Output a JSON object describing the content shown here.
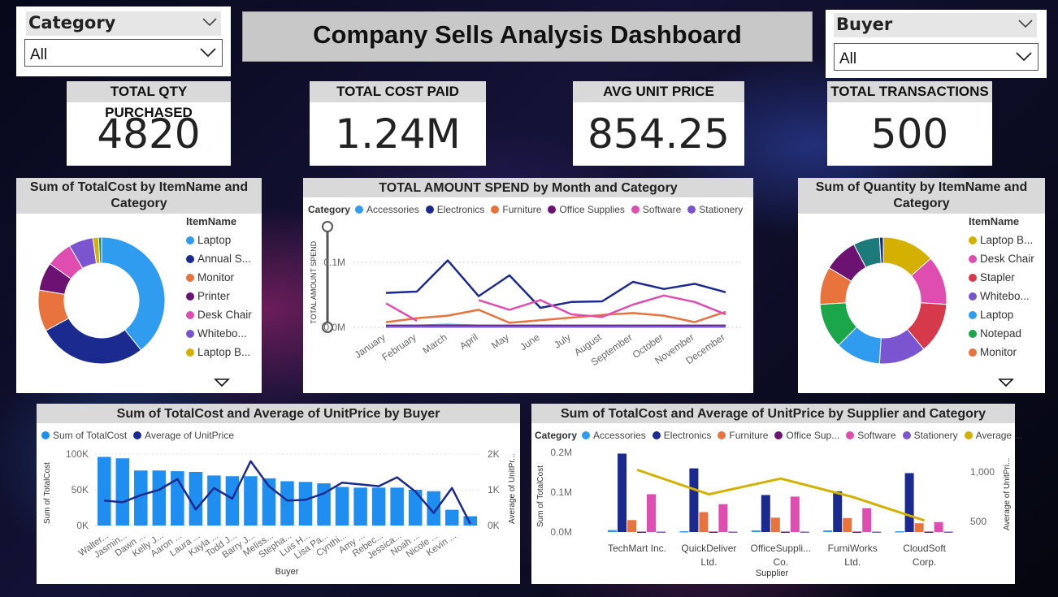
{
  "dashboard_title": "Company Sells Analysis Dashboard",
  "slicers": {
    "category": {
      "label": "Category",
      "value": "All"
    },
    "buyer": {
      "label": "Buyer",
      "value": "All"
    }
  },
  "kpis": [
    {
      "label": "TOTAL QTY PURCHASED",
      "value": "4820"
    },
    {
      "label": "TOTAL COST PAID",
      "value": "1.24M"
    },
    {
      "label": "AVG UNIT PRICE",
      "value": "854.25"
    },
    {
      "label": "TOTAL TRANSACTIONS",
      "value": "500"
    }
  ],
  "colors": {
    "Accessories": "#2f9cf0",
    "Electronics": "#1a2a8f",
    "Furniture": "#e8733d",
    "Office Supplies": "#6b1273",
    "Software": "#e04db0",
    "Stationery": "#7b55d0",
    "Average": "#d4b000",
    "bar": "#1e8ff0",
    "line": "#1a2a8f"
  },
  "donut_cost": {
    "title": "Sum of TotalCost by ItemName and Category",
    "legend_title": "ItemName",
    "legend": [
      {
        "label": "Laptop",
        "color": "#2f9cf0"
      },
      {
        "label": "Annual S...",
        "color": "#1a2a8f"
      },
      {
        "label": "Monitor",
        "color": "#e8733d"
      },
      {
        "label": "Printer",
        "color": "#6b1273"
      },
      {
        "label": "Desk Chair",
        "color": "#e04db0"
      },
      {
        "label": "Whitebo...",
        "color": "#7b55d0"
      },
      {
        "label": "Laptop B...",
        "color": "#d4b000"
      }
    ],
    "slices": [
      {
        "value": 41,
        "color": "#2f9cf0"
      },
      {
        "value": 29,
        "color": "#1a2a8f"
      },
      {
        "value": 11,
        "color": "#e8733d"
      },
      {
        "value": 7.5,
        "color": "#6b1273"
      },
      {
        "value": 7,
        "color": "#e04db0"
      },
      {
        "value": 6.5,
        "color": "#7b55d0"
      },
      {
        "value": 1.5,
        "color": "#d4b000"
      },
      {
        "value": 0.8,
        "color": "#1c8c78"
      }
    ]
  },
  "donut_qty": {
    "title": "Sum of Quantity by ItemName and Category",
    "legend_title": "ItemName",
    "legend": [
      {
        "label": "Laptop B...",
        "color": "#d4b000"
      },
      {
        "label": "Desk Chair",
        "color": "#e04db0"
      },
      {
        "label": "Stapler",
        "color": "#d63a4a"
      },
      {
        "label": "Whitebo...",
        "color": "#7b55d0"
      },
      {
        "label": "Laptop",
        "color": "#2f9cf0"
      },
      {
        "label": "Notepad",
        "color": "#1ca64a"
      },
      {
        "label": "Monitor",
        "color": "#e8733d"
      }
    ],
    "slices": [
      {
        "value": 14,
        "color": "#d4b000"
      },
      {
        "value": 13,
        "color": "#e04db0"
      },
      {
        "value": 13.5,
        "color": "#d63a4a"
      },
      {
        "value": 12.5,
        "color": "#7b55d0"
      },
      {
        "value": 12,
        "color": "#2f9cf0"
      },
      {
        "value": 12,
        "color": "#1ca64a"
      },
      {
        "value": 10,
        "color": "#e8733d"
      },
      {
        "value": 9,
        "color": "#6b1273"
      },
      {
        "value": 7,
        "color": "#1c7a7a"
      },
      {
        "value": 1,
        "color": "#1a2a8f"
      }
    ]
  },
  "line_chart": {
    "title": "TOTAL AMOUNT SPEND by Month and Category",
    "legend_title": "Category",
    "ylabel": "TOTAL AMOUNT SPEND",
    "yticks": [
      "0.1M",
      "0.0M"
    ],
    "months": [
      "January",
      "February",
      "March",
      "April",
      "May",
      "June",
      "July",
      "August",
      "September",
      "October",
      "November",
      "December"
    ],
    "series": [
      {
        "name": "Accessories",
        "color": "#2f9cf0",
        "values": [
          3,
          3,
          4,
          3,
          3,
          3,
          3,
          3,
          3,
          3,
          3,
          3
        ]
      },
      {
        "name": "Electronics",
        "color": "#1a2a8f",
        "values": [
          53,
          55,
          103,
          48,
          80,
          30,
          39,
          40,
          70,
          59,
          67,
          54
        ]
      },
      {
        "name": "Furniture",
        "color": "#e8733d",
        "values": [
          8,
          14,
          18,
          27,
          7,
          11,
          15,
          19,
          22,
          18,
          8,
          24
        ]
      },
      {
        "name": "Office Supplies",
        "color": "#6b1273",
        "values": [
          2,
          2,
          2,
          2,
          2,
          2,
          2,
          2,
          2,
          2,
          2,
          2
        ]
      },
      {
        "name": "Software",
        "color": "#e04db0",
        "values": [
          37,
          10,
          null,
          42,
          27,
          42,
          20,
          16,
          35,
          49,
          39,
          20
        ]
      },
      {
        "name": "Stationery",
        "color": "#7b55d0",
        "values": [
          1,
          1,
          1,
          1,
          1,
          1,
          1,
          1,
          1,
          1,
          1,
          1
        ]
      }
    ]
  },
  "buyer_chart": {
    "title": "Sum of TotalCost and Average of UnitPrice by Buyer",
    "legend": [
      {
        "label": "Sum of TotalCost",
        "color": "#1e8ff0"
      },
      {
        "label": "Average of UnitPrice",
        "color": "#1a2a8f"
      }
    ],
    "xlabel": "Buyer",
    "ylabel_left": "Sum of TotalCost",
    "ylabel_right": "Average of UnitPr...",
    "yticks_left": [
      "100K",
      "50K",
      "0K"
    ],
    "yticks_right": [
      "2K",
      "1K",
      "0K"
    ],
    "buyers": [
      "Walter...",
      "Jasmin...",
      "Dawn ...",
      "Kelly J...",
      "Aaron ...",
      "Laura ...",
      "Kayla ...",
      "Todd J...",
      "Barry J...",
      "Meliss...",
      "Stepha...",
      "Luis H...",
      "Lisa Pa...",
      "Cynthi...",
      "Amy ...",
      "Rebec...",
      "Jessica...",
      "Noah ...",
      "Nicole ...",
      "Kevin ..."
    ],
    "total_cost": [
      96,
      94,
      77,
      77,
      76,
      75,
      70,
      69,
      69,
      66,
      62,
      61,
      59,
      54,
      53,
      53,
      53,
      50,
      48,
      22,
      13
    ],
    "avg_unit_price": [
      0.7,
      0.65,
      0.85,
      1.0,
      1.3,
      0.45,
      1.05,
      0.75,
      1.8,
      1.1,
      0.7,
      0.72,
      0.9,
      1.2,
      1.15,
      1.1,
      1.35,
      0.95,
      0.35,
      1.05,
      0.05
    ]
  },
  "supplier_chart": {
    "title": "Sum of TotalCost and Average of UnitPrice by Supplier and Category",
    "legend_title": "Category",
    "legend": [
      "Accessories",
      "Electronics",
      "Furniture",
      "Office Sup...",
      "Software",
      "Stationery",
      "Average ..."
    ],
    "xlabel": "Supplier",
    "ylabel_left": "Sum of TotalCost",
    "ylabel_right": "Average of UnitPri...",
    "yticks_left": [
      "0.2M",
      "0.1M",
      "0.0M"
    ],
    "yticks_right": [
      "1,000",
      "500"
    ],
    "suppliers": [
      [
        "TechMart Inc."
      ],
      [
        "QuickDeliver",
        "Ltd."
      ],
      [
        "OfficeSuppli...",
        "Co."
      ],
      [
        "FurniWorks",
        "Ltd."
      ],
      [
        "CloudSoft",
        "Corp."
      ]
    ],
    "series": [
      {
        "name": "Accessories",
        "values": [
          0.005,
          0.002,
          0.004,
          0.004,
          0.002
        ]
      },
      {
        "name": "Electronics",
        "values": [
          0.197,
          0.16,
          0.093,
          0.102,
          0.148
        ]
      },
      {
        "name": "Furniture",
        "values": [
          0.03,
          0.05,
          0.036,
          0.035,
          0.022
        ]
      },
      {
        "name": "Office Supplies",
        "values": [
          0.001,
          0.001,
          0.001,
          0.001,
          0.001
        ]
      },
      {
        "name": "Software",
        "values": [
          0.095,
          0.07,
          0.089,
          0.06,
          0.025
        ]
      },
      {
        "name": "Stationery",
        "values": [
          0.001,
          0.001,
          0.001,
          0.001,
          0.001
        ]
      }
    ],
    "average": [
      1100,
      820,
      1000,
      790,
      520
    ]
  }
}
